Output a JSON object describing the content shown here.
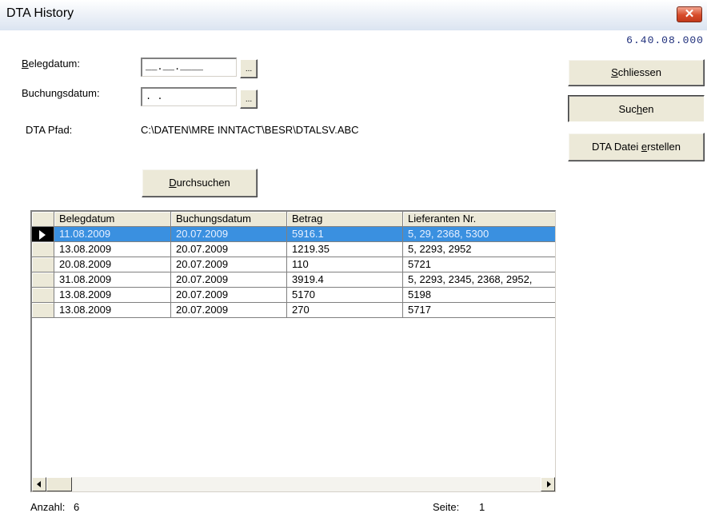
{
  "window": {
    "title": "DTA History",
    "close_label": "✕",
    "version": "6.40.08.000"
  },
  "form": {
    "belegdatum_label_first": "B",
    "belegdatum_label_rest": "elegdatum:",
    "belegdatum_value": "__.__.____",
    "buchungsdatum_label": "Buchungsdatum:",
    "buchungsdatum_value": " . .",
    "dots_label": "...",
    "pfad_label": "DTA Pfad:",
    "pfad_value": "C:\\DATEN\\MRE INNTACT\\BESR\\DTALSV.ABC",
    "durchsuchen_first": "D",
    "durchsuchen_rest": "urchsuchen"
  },
  "buttons": {
    "schliessen_first": "S",
    "schliessen_rest": "chliessen",
    "suchen_a": "Suc",
    "suchen_u": "h",
    "suchen_b": "en",
    "dta_a": "DTA Datei ",
    "dta_u": "e",
    "dta_b": "rstellen"
  },
  "grid": {
    "columns": [
      "Belegdatum",
      "Buchungsdatum",
      "Betrag",
      "Lieferanten Nr."
    ],
    "rows": [
      [
        "11.08.2009",
        "20.07.2009",
        "5916.1",
        "5, 29, 2368, 5300"
      ],
      [
        "13.08.2009",
        "20.07.2009",
        "1219.35",
        "5, 2293, 2952"
      ],
      [
        "20.08.2009",
        "20.07.2009",
        "110",
        "5721"
      ],
      [
        "31.08.2009",
        "20.07.2009",
        "3919.4",
        "5, 2293, 2345, 2368, 2952,"
      ],
      [
        "13.08.2009",
        "20.07.2009",
        "5170",
        "5198"
      ],
      [
        "13.08.2009",
        "20.07.2009",
        "270",
        "5717"
      ]
    ],
    "selected_row": 0
  },
  "footer": {
    "anzahl_label": "Anzahl:",
    "anzahl_value": "6",
    "seite_label": "Seite:",
    "seite_value": "1"
  },
  "colors": {
    "selection": "#3a90e0",
    "version_text": "#1d2d7a",
    "close_button": "#d74b2a"
  }
}
